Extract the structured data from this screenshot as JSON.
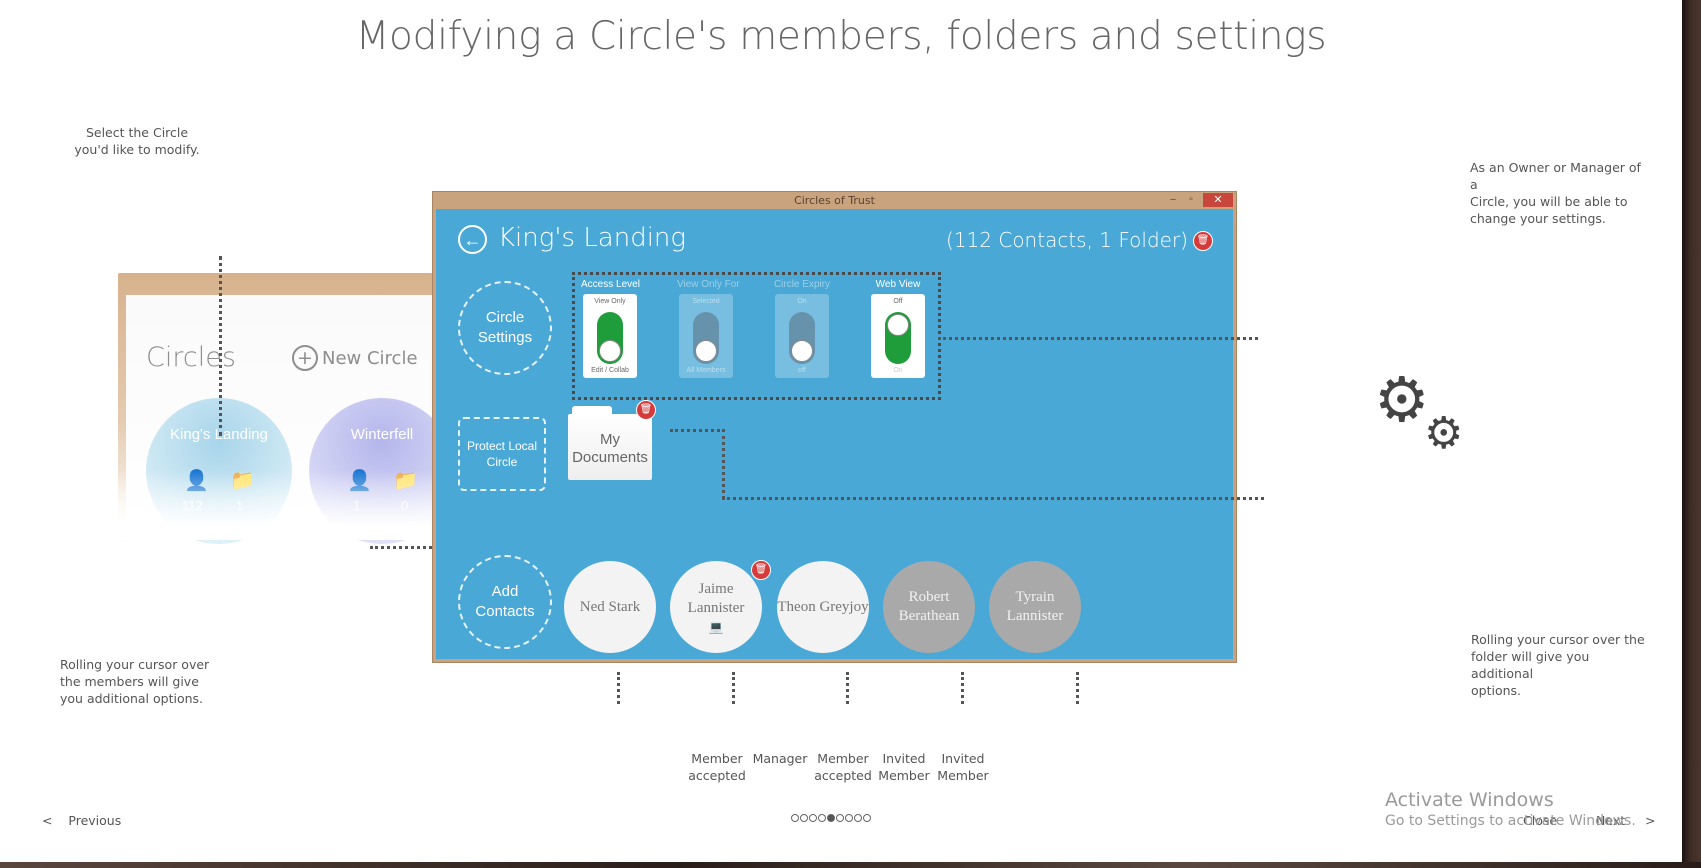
{
  "title": "Modifying a Circle's members, folders and settings",
  "notes": {
    "select_circle": [
      "Select the Circle",
      "you'd like to modify."
    ],
    "owner_manager": [
      "As an Owner or Manager of a",
      "Circle, you will be able to",
      "change your settings."
    ],
    "members_hover": [
      "Rolling your cursor over",
      "the members will give",
      "you additional options."
    ],
    "folder_hover": [
      "Rolling your cursor over the",
      "folder will give you additional",
      "options."
    ]
  },
  "background_window": {
    "heading": "Circles",
    "new_circle": "New Circle",
    "circles": [
      {
        "name": "King's Landing",
        "contacts": "112",
        "folders": "1"
      },
      {
        "name": "Winterfell",
        "contacts": "1",
        "folders": "0"
      }
    ]
  },
  "window": {
    "title": "Circles of Trust",
    "minimize": "–",
    "maximize": "▫",
    "close": "✕",
    "circle_name": "King's Landing",
    "summary": "(112 Contacts, 1 Folder)",
    "circle_settings": "Circle Settings",
    "protect_local": "Protect Local Circle",
    "add_contacts": "Add Contacts",
    "settings": [
      {
        "label": "Access Level",
        "top": "View Only",
        "bottom": "Edit / Collab",
        "enabled": true,
        "state": "bottom"
      },
      {
        "label": "View Only For",
        "top": "Selected",
        "bottom": "All Members",
        "enabled": false,
        "state": "bottom"
      },
      {
        "label": "Circle Expiry",
        "top": "On",
        "bottom": "off",
        "enabled": false,
        "state": "bottom"
      },
      {
        "label": "Web View",
        "top": "Off",
        "bottom": "On",
        "enabled": true,
        "state": "top"
      }
    ],
    "folder": {
      "name": "My Documents"
    },
    "members": [
      {
        "name": "Ned Stark",
        "status": "accepted",
        "device": ""
      },
      {
        "name": "Jaime Lannister",
        "status": "accepted",
        "device": "💻"
      },
      {
        "name": "Theon Greyjoy",
        "status": "accepted",
        "device": ""
      },
      {
        "name": "Robert Berathean",
        "status": "invited",
        "device": ""
      },
      {
        "name": "Tyrain Lannister",
        "status": "invited",
        "device": ""
      }
    ]
  },
  "roles": [
    "Member accepted",
    "Manager",
    "Member accepted",
    "Invited Member",
    "Invited Member"
  ],
  "navigation": {
    "previous": "Previous",
    "next": "Next",
    "close": "Close",
    "page_count": 9,
    "current_page": 5
  },
  "watermark": {
    "line1": "Activate Windows",
    "line2": "Go to Settings to activate Windows."
  },
  "colors": {
    "window_frame": "#c9a27e",
    "window_content": "#4aa8d6",
    "toggle_on": "#1f9d3b",
    "delete_badge": "#d63b3b"
  }
}
